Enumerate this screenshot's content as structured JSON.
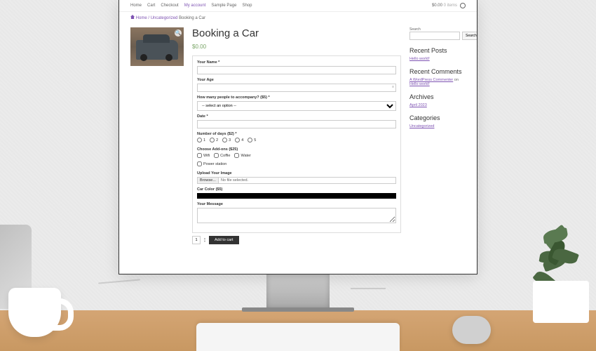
{
  "nav": {
    "home": "Home",
    "cart": "Cart",
    "checkout": "Checkout",
    "account": "My account",
    "sample": "Sample Page",
    "shop": "Shop",
    "cart_total": "$0.00",
    "cart_items": "0 items"
  },
  "breadcrumb": {
    "home": "Home",
    "cat": "Uncategorized",
    "current": "Booking a Car"
  },
  "product": {
    "title": "Booking a Car",
    "price": "$0.00"
  },
  "form": {
    "name_label": "Your Name *",
    "age_label": "Your Age",
    "people_label": "How many people to accompany? ($5) *",
    "people_placeholder": "-- select an option --",
    "date_label": "Date *",
    "days_label": "Number of days ($2) *",
    "days_options": [
      "1",
      "2",
      "3",
      "4",
      "5"
    ],
    "addons_label": "Choose Add-ons ($25)",
    "addons": [
      "Wifi",
      "Coffie",
      "Water",
      "Power station"
    ],
    "upload_label": "Upload Your Image",
    "browse": "Browse...",
    "no_file": "No file selected.",
    "color_label": "Car Color ($5)",
    "message_label": "Your Message",
    "qty": "1",
    "add_to_cart": "Add to cart"
  },
  "sidebar": {
    "search": {
      "label": "Search",
      "button": "Search"
    },
    "recent_posts": {
      "title": "Recent Posts",
      "items": [
        "Hello world!"
      ]
    },
    "recent_comments": {
      "title": "Recent Comments",
      "text_pre": "A WordPress Commenter",
      "on": " on ",
      "link": "Hello world!"
    },
    "archives": {
      "title": "Archives",
      "items": [
        "April 2023"
      ]
    },
    "categories": {
      "title": "Categories",
      "items": [
        "Uncategorized"
      ]
    }
  }
}
